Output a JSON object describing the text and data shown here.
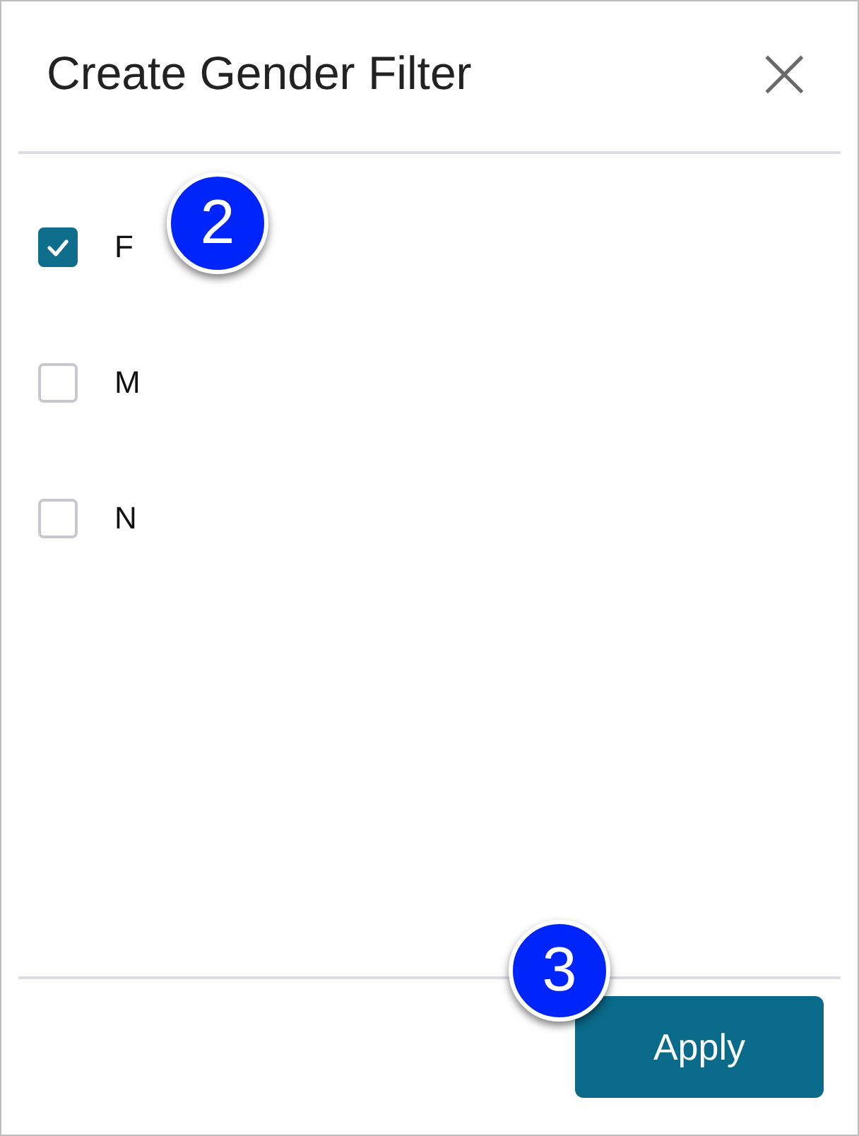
{
  "dialog": {
    "title": "Create Gender Filter",
    "close": "×"
  },
  "options": [
    {
      "label": "F",
      "checked": true
    },
    {
      "label": "M",
      "checked": false
    },
    {
      "label": "N",
      "checked": false
    }
  ],
  "apply_button": "Apply",
  "callouts": [
    {
      "number": "2"
    },
    {
      "number": "3"
    }
  ]
}
